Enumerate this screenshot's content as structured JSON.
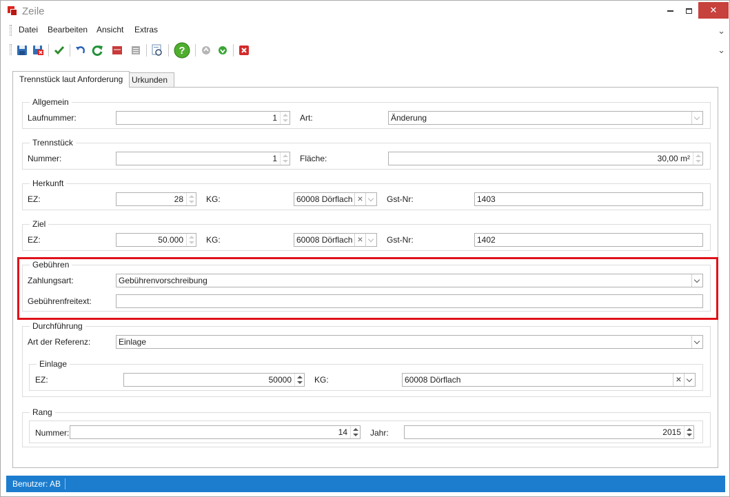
{
  "window": {
    "title": "Zeile"
  },
  "menu": {
    "items": [
      "Datei",
      "Bearbeiten",
      "Ansicht",
      "Extras"
    ]
  },
  "toolbar": {
    "buttons": [
      "save-icon",
      "save-close-icon",
      "checkmark-icon",
      "undo-icon",
      "refresh-icon",
      "delete-record-icon",
      "list-icon",
      "preview-icon",
      "help-icon",
      "move-up-icon",
      "move-down-icon",
      "close-icon"
    ]
  },
  "tabs": [
    {
      "label": "Trennstück laut Anforderung",
      "active": true
    },
    {
      "label": "Urkunden",
      "active": false
    }
  ],
  "allgemein": {
    "title": "Allgemein",
    "laufnummer_label": "Laufnummer:",
    "laufnummer_value": "1",
    "art_label": "Art:",
    "art_value": "Änderung"
  },
  "trennstueck": {
    "title": "Trennstück",
    "nummer_label": "Nummer:",
    "nummer_value": "1",
    "flaeche_label": "Fläche:",
    "flaeche_value": "30,00 m²"
  },
  "herkunft": {
    "title": "Herkunft",
    "ez_label": "EZ:",
    "ez_value": "28",
    "kg_label": "KG:",
    "kg_value": "60008 Dörflach",
    "gst_label": "Gst-Nr:",
    "gst_value": "1403"
  },
  "ziel": {
    "title": "Ziel",
    "ez_label": "EZ:",
    "ez_value": "50.000",
    "kg_label": "KG:",
    "kg_value": "60008 Dörflach",
    "gst_label": "Gst-Nr:",
    "gst_value": "1402"
  },
  "gebuehren": {
    "title": "Gebühren",
    "zahlungsart_label": "Zahlungsart:",
    "zahlungsart_value": "Gebührenvorschreibung",
    "freitext_label": "Gebührenfreitext:",
    "freitext_value": ""
  },
  "durchfuehrung": {
    "title": "Durchführung",
    "referenz_label": "Art der Referenz:",
    "referenz_value": "Einlage",
    "einlage": {
      "title": "Einlage",
      "ez_label": "EZ:",
      "ez_value": "50000",
      "kg_label": "KG:",
      "kg_value": "60008 Dörflach"
    }
  },
  "rang": {
    "title": "Rang",
    "nummer_label": "Nummer:",
    "nummer_value": "14",
    "jahr_label": "Jahr:",
    "jahr_value": "2015"
  },
  "status": {
    "text": "Benutzer: AB"
  },
  "colors": {
    "highlight": "#e0121a",
    "statusbar": "#1c7dcf",
    "close_button": "#c7413d"
  }
}
